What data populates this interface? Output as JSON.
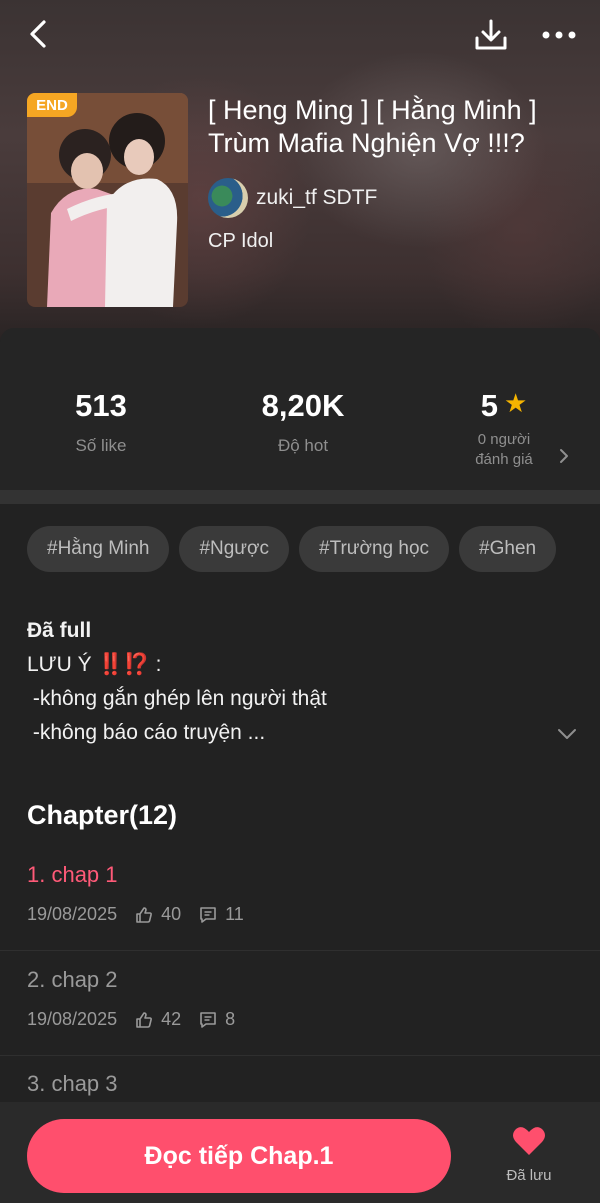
{
  "header": {
    "back_icon": "chevron-left-icon",
    "download_icon": "download-icon",
    "more_icon": "more-horizontal-icon"
  },
  "story": {
    "badge": "END",
    "title": "[ Heng Ming ] [ Hằng Minh ] Trùm Mafia Nghiện Vợ !!!?",
    "author": "zuki_tf SDTF",
    "category": "CP Idol"
  },
  "stats": {
    "likes_value": "513",
    "likes_label": "Số like",
    "hot_value": "8,20K",
    "hot_label": "Độ hot",
    "rating_value": "5",
    "rating_label_line1": "0 người",
    "rating_label_line2": "đánh giá"
  },
  "tags": [
    "#Hằng Minh",
    "#Ngược",
    "#Trường học",
    "#Ghen"
  ],
  "description": {
    "status": "Đã full",
    "note_label": "LƯU Ý",
    "note_marks": "‼️⁉️",
    "note_colon": ":",
    "line1": " -không gắn ghép lên người thật",
    "line2": " -không báo cáo truyện ..."
  },
  "chapters": {
    "heading": "Chapter(12)",
    "items": [
      {
        "title": "1. chap 1",
        "date": "19/08/2025",
        "likes": "40",
        "comments": "11"
      },
      {
        "title": "2. chap 2",
        "date": "19/08/2025",
        "likes": "42",
        "comments": "8"
      },
      {
        "title": "3. chap 3"
      }
    ]
  },
  "bottom": {
    "read_label": "Đọc tiếp Chap.1",
    "saved_label": "Đã lưu"
  },
  "colors": {
    "accent": "#ff4f6d",
    "active_chapter": "#ff5a78",
    "star": "#f5b400",
    "badge": "#f5a623"
  }
}
